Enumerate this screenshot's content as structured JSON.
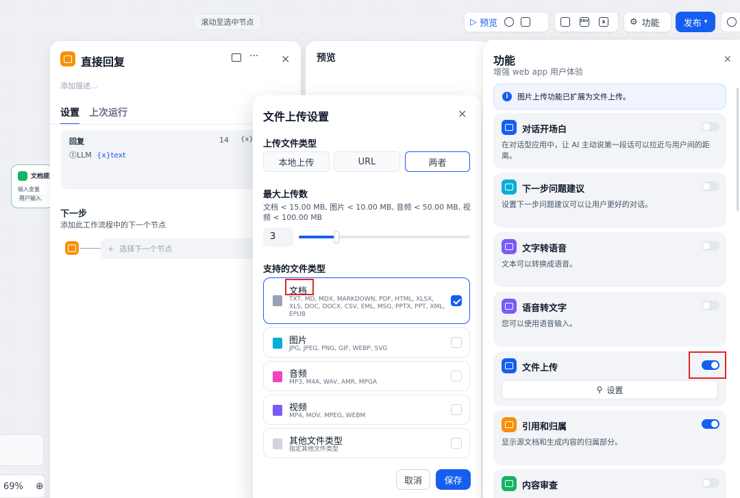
{
  "canvas": {
    "scroll_to_selected": "滚动至选中节点",
    "zoom": "69%"
  },
  "toolbar": {
    "preview": "预览",
    "features": "功能",
    "publish": "发布",
    "env": "ENV"
  },
  "node_panel": {
    "title": "直接回复",
    "desc_placeholder": "添加描述...",
    "tabs": [
      "设置",
      "上次运行"
    ],
    "reply_label": "回复",
    "reply_count": "14",
    "var_token": "{x}",
    "llm_label": "LLM",
    "text_var": "{x}text",
    "next_step_title": "下一步",
    "next_step_desc": "添加此工作流程中的下一个节点",
    "select_next": "选择下一个节点"
  },
  "canvas_node": {
    "title": "文档提取",
    "input_label": "输入变量",
    "user_input": "用户输入"
  },
  "preview": {
    "title": "预览"
  },
  "dialog": {
    "title": "文件上传设置",
    "upload_type_label": "上传文件类型",
    "upload_types": [
      "本地上传",
      "URL",
      "两者"
    ],
    "selected_upload_type": "两者",
    "max_count_label": "最大上传数",
    "max_count_desc": "文档 < 15.00 MB, 图片 < 10.00 MB, 音频 < 50.00 MB, 视频 < 100.00 MB",
    "max_count_value": "3",
    "slider_fraction": 0.22,
    "file_types_label": "支持的文件类型",
    "file_types": [
      {
        "name": "文档",
        "desc": "TXT, MD, MDX, MARKDOWN, PDF, HTML, XLSX, XLS, DOC, DOCX, CSV, EML, MSG, PPTX, PPT, XML, EPUB",
        "checked": true,
        "color": "#98a2b3"
      },
      {
        "name": "图片",
        "desc": "JPG, JPEG, PNG, GIF, WEBP, SVG",
        "checked": false,
        "color": "#06aed4"
      },
      {
        "name": "音频",
        "desc": "MP3, M4A, WAV, AMR, MPGA",
        "checked": false,
        "color": "#ee46bc"
      },
      {
        "name": "视频",
        "desc": "MP4, MOV, MPEG, WEBM",
        "checked": false,
        "color": "#7a5af8"
      },
      {
        "name": "其他文件类型",
        "desc": "指定其他文件类型",
        "checked": false,
        "color": "#d0d5dd"
      }
    ],
    "cancel": "取消",
    "save": "保存"
  },
  "features": {
    "title": "功能",
    "subtitle": "增强 web app 用户体验",
    "info": "图片上传功能已扩展为文件上传。",
    "items": [
      {
        "name": "对话开场白",
        "desc": "在对话型应用中，让 AI 主动说第一段话可以拉近与用户间的距离。",
        "on": false,
        "color": "#155eef"
      },
      {
        "name": "下一步问题建议",
        "desc": "设置下一步问题建议可以让用户更好的对话。",
        "on": false,
        "color": "#06aed4"
      },
      {
        "name": "文字转语音",
        "desc": "文本可以转换成语音。",
        "on": false,
        "color": "#7a5af8"
      },
      {
        "name": "语音转文字",
        "desc": "您可以使用语音输入。",
        "on": false,
        "color": "#7a5af8"
      },
      {
        "name": "文件上传",
        "desc": "",
        "on": true,
        "color": "#155eef",
        "button": "设置"
      },
      {
        "name": "引用和归属",
        "desc": "显示源文档和生成内容的归属部分。",
        "on": true,
        "color": "#f79009"
      },
      {
        "name": "内容审查",
        "desc": "",
        "on": false,
        "color": "#16b364"
      }
    ]
  }
}
